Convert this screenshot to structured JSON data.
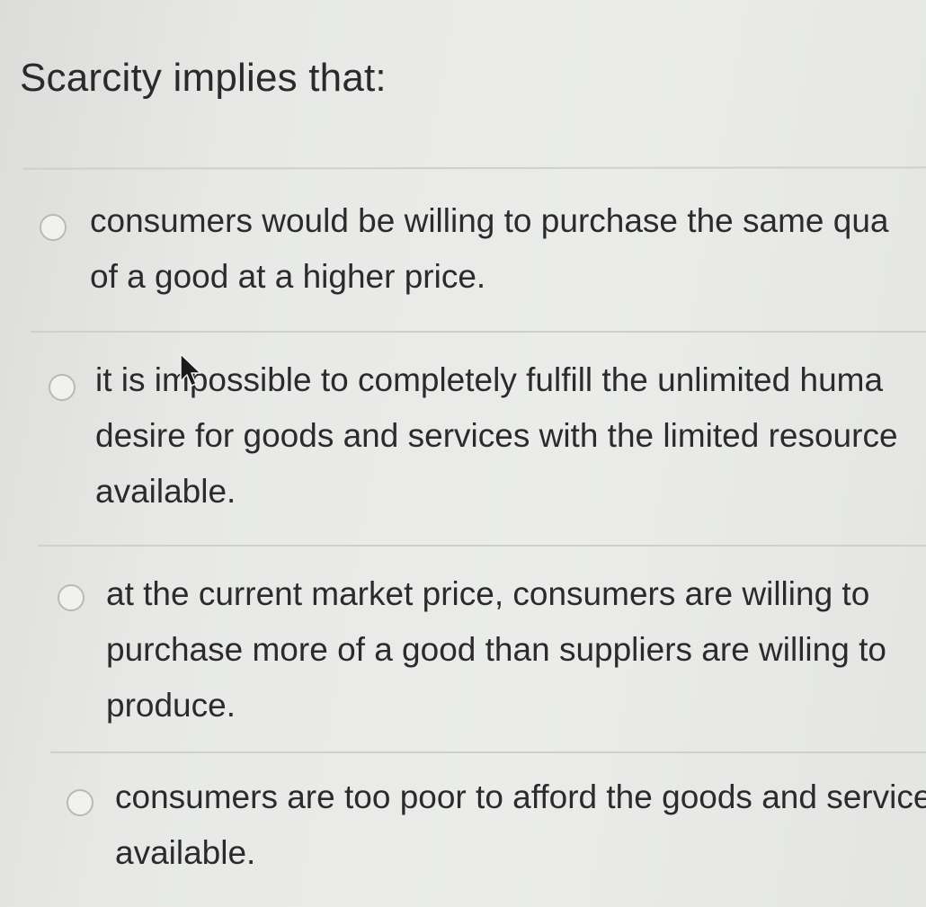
{
  "question": {
    "title": "Scarcity implies that:"
  },
  "options": [
    {
      "text": "consumers would be willing to purchase the same qua\nof a good at a higher price.",
      "selected": false
    },
    {
      "text": "it is impossible to completely fulfill the unlimited huma\ndesire for goods and services with the limited resource\navailable.",
      "selected": false
    },
    {
      "text": "at the current market price, consumers are willing to\npurchase more of a good than suppliers are willing to\nproduce.",
      "selected": false
    },
    {
      "text": "consumers are too poor to afford the goods and service\navailable.",
      "selected": false
    }
  ],
  "icons": {
    "cursor": "mouse-pointer-icon"
  }
}
